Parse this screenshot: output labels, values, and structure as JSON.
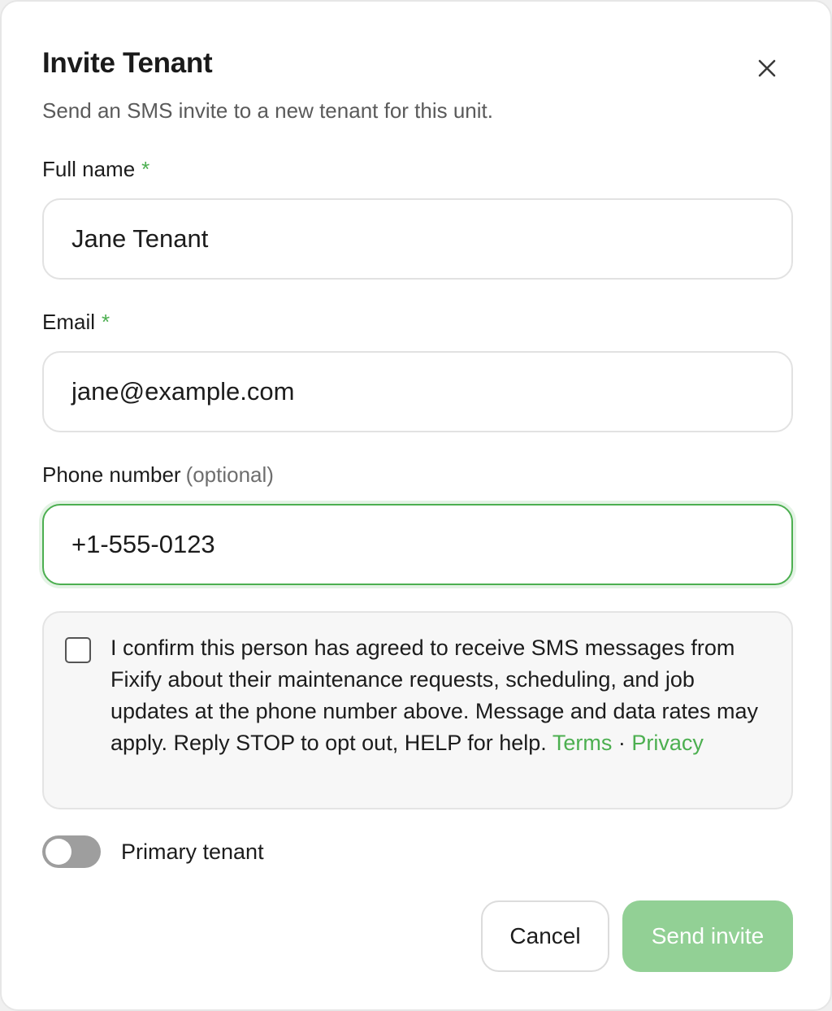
{
  "dialog": {
    "title": "Invite Tenant",
    "subtitle": "Send an SMS invite to a new tenant for this unit.",
    "close_icon": "close-icon"
  },
  "fields": {
    "full_name": {
      "label": "Full name",
      "required_mark": "*",
      "value": "Jane Tenant"
    },
    "email": {
      "label": "Email",
      "required_mark": "*",
      "value": "jane@example.com"
    },
    "phone": {
      "label": "Phone number",
      "optional_note": "(optional)",
      "value": "+1-555-0123"
    }
  },
  "consent": {
    "checked": false,
    "text": "I confirm this person has agreed to receive SMS messages from Fixify about their maintenance requests, scheduling, and job updates at the phone number above. Message and data rates may apply. Reply STOP to opt out, HELP for help.",
    "terms_link": "Terms",
    "separator": "·",
    "privacy_link": "Privacy"
  },
  "primary_tenant": {
    "label": "Primary tenant",
    "enabled": false
  },
  "actions": {
    "cancel_label": "Cancel",
    "send_label": "Send invite"
  },
  "colors": {
    "accent": "#4caf50",
    "send_button_disabled": "#92d095",
    "toggle_off": "#9e9e9e"
  }
}
